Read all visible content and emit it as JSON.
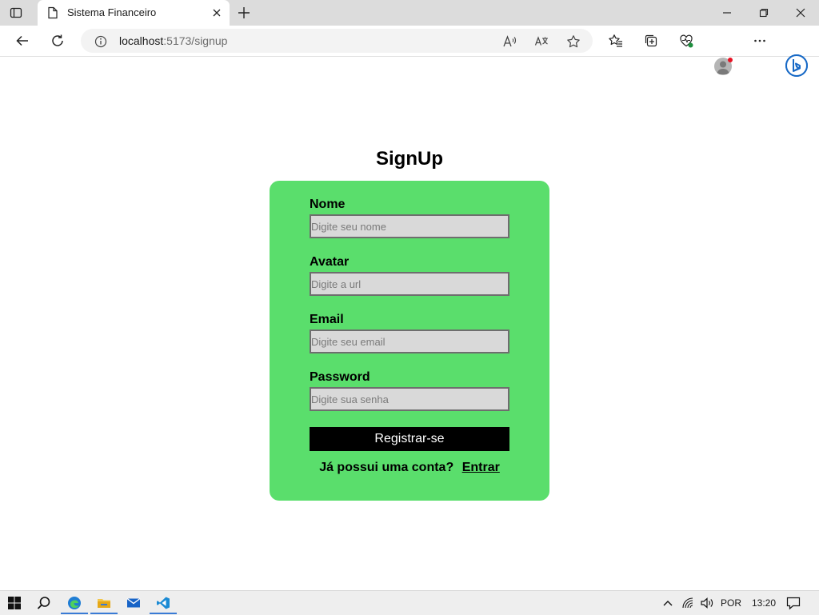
{
  "browser": {
    "tab_title": "Sistema Financeiro",
    "url_host": "localhost",
    "url_path": ":5173/signup"
  },
  "page": {
    "title": "SignUp"
  },
  "form": {
    "fields": [
      {
        "label": "Nome",
        "placeholder": "Digite seu nome",
        "value": ""
      },
      {
        "label": "Avatar",
        "placeholder": "Digite a url",
        "value": ""
      },
      {
        "label": "Email",
        "placeholder": "Digite seu email",
        "value": ""
      },
      {
        "label": "Password",
        "placeholder": "Digite sua senha",
        "value": ""
      }
    ],
    "submit_label": "Registrar-se",
    "login_prompt": "Já possui uma conta?",
    "login_link": "Entrar"
  },
  "taskbar": {
    "language": "POR",
    "time": "13:20"
  },
  "colors": {
    "card_bg": "#5ade6c",
    "input_bg": "#d9d9d9",
    "button_bg": "#000000",
    "button_text": "#ffffff",
    "taskbar_accent": "#3a7bd5"
  },
  "icons": [
    "sidebar-toggle-icon",
    "page-icon",
    "close-icon",
    "plus-icon",
    "minimize-icon",
    "restore-icon",
    "window-close-icon",
    "back-arrow-icon",
    "refresh-icon",
    "info-icon",
    "read-aloud-icon",
    "translate-icon",
    "star-icon",
    "favorites-icon",
    "collections-icon",
    "browser-essentials-icon",
    "profile-icon",
    "more-icon",
    "bing-icon",
    "windows-start-icon",
    "search-icon",
    "edge-icon",
    "file-explorer-icon",
    "mail-icon",
    "vscode-icon",
    "chevron-up-icon",
    "network-icon",
    "volume-icon",
    "notification-icon"
  ]
}
